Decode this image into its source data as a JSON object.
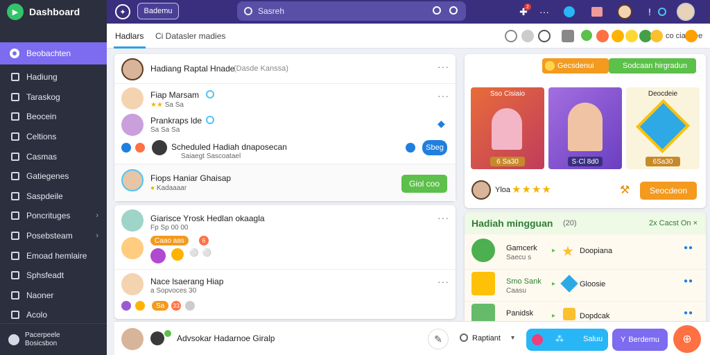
{
  "app": {
    "name": "Dashboard"
  },
  "sidebar": {
    "active": "Beobachten",
    "items": [
      {
        "label": "Hadiung",
        "chevron": false
      },
      {
        "label": "Taraskog",
        "chevron": false
      },
      {
        "label": "Beocein",
        "chevron": false
      },
      {
        "label": "Celtions",
        "chevron": false
      },
      {
        "label": "Casmas",
        "chevron": false
      },
      {
        "label": "Gatiegenes",
        "chevron": false
      },
      {
        "label": "Saspdeile",
        "chevron": false
      },
      {
        "label": "Poncrituges",
        "chevron": true
      },
      {
        "label": "Posebsteam",
        "chevron": true
      },
      {
        "label": "Emoad hemlaire",
        "chevron": false
      },
      {
        "label": "Sphsfeadt",
        "chevron": false
      },
      {
        "label": "Naoner",
        "chevron": false
      },
      {
        "label": "Acolo",
        "chevron": false
      }
    ],
    "footer": {
      "line1": "Pacerpeele",
      "line2": "Bosicsbon"
    }
  },
  "topbar": {
    "button_label": "Bademu",
    "search_placeholder": "Sasreh",
    "notification_badge": "2"
  },
  "tabs": {
    "primary": "Hadlars",
    "secondary": "Ci Datasler madies",
    "right_text": "co ciaodee"
  },
  "feed": {
    "header": {
      "title": "Hadiang Raptal Hnade",
      "meta": "(Dasde Kanssa)"
    },
    "posts": [
      {
        "name": "Fiap Marsam",
        "sub": "Sa Sa"
      },
      {
        "name": "Prankraps lde",
        "sub": "Sa Sa Sa"
      },
      {
        "name": "Scheduled Hadiah dnaposecan",
        "sub": "Saiaegt Sascoatael"
      }
    ],
    "share_label": "Sbeg",
    "invite": {
      "name": "Fiops Haniar Ghaisap",
      "sub": "Kadaaaar",
      "button": "Giol coo"
    }
  },
  "post2": {
    "items": [
      {
        "name": "Giarisce Yrosk Hedlan okaagla",
        "sub": "Fp Sp 00 00"
      },
      {
        "badge": "Caao aas",
        "badge_num": "6"
      },
      {
        "name": "Nace lsaerang Hiap",
        "sub": "a Sopvoces 30"
      },
      {
        "badge": "Sa",
        "badge_num": "33"
      }
    ]
  },
  "store": {
    "tab_orange": "Gecsdenui",
    "tab_green": "Sodcaan hirgradun",
    "games": [
      {
        "title": "Sso Cisiaio",
        "price": "6 Sa30"
      },
      {
        "title": "",
        "price": "S·Cl 8d0"
      },
      {
        "title": "Deocdeie",
        "price": "6Sa30"
      }
    ],
    "rating_label": "Yloa",
    "rating_stars": 4,
    "button": "Seocdeon"
  },
  "rewards": {
    "title": "Hadiah mingguan",
    "title_meta": "(20)",
    "right_link": "2x Cacst On ×",
    "rows": [
      {
        "label": "Gamcerk",
        "sub": "Saecu s",
        "reward": "Doopiana"
      },
      {
        "label": "Smo Sank",
        "sub": "Caasu",
        "reward": "Gloosie"
      },
      {
        "label": "Panidsk",
        "sub": "",
        "reward": "Dopdcak"
      }
    ]
  },
  "bottom": {
    "name": "Advsokar Hadarnoe Giralp",
    "dropdown": "Raptiant",
    "btn_blue": "Saluu",
    "btn_purple": "Berdemu"
  },
  "colors": {
    "accent": "#7d6bf0",
    "topbar": "#3a2f7e",
    "green": "#5cc04a",
    "orange": "#f39a1f",
    "blue": "#1f7fe0"
  }
}
